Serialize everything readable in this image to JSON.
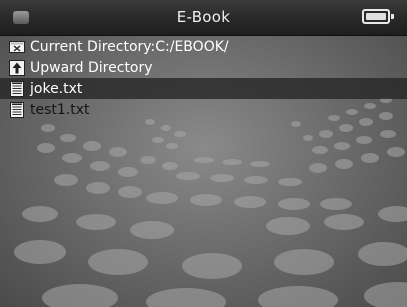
{
  "header": {
    "title": "E-Book"
  },
  "file_list": {
    "items": [
      {
        "label": "Current Directory:C:/EBOOK/",
        "icon": "folder-x-icon"
      },
      {
        "label": "Upward Directory",
        "icon": "upward-arrow-icon"
      },
      {
        "label": "joke.txt",
        "icon": "text-file-icon"
      },
      {
        "label": "test1.txt",
        "icon": "text-file-icon"
      }
    ],
    "selected_index": 2
  },
  "colors": {
    "titlebar": "#2a2a2a",
    "background": "#707070",
    "selection": "#282828",
    "text": "#ffffff"
  }
}
